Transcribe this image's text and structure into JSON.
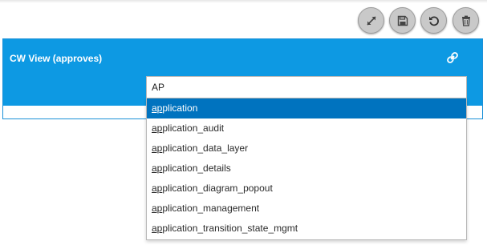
{
  "toolbar": {
    "buttons": [
      {
        "name": "expand",
        "icon": "expand-icon"
      },
      {
        "name": "save",
        "icon": "save-icon"
      },
      {
        "name": "refresh",
        "icon": "refresh-icon"
      },
      {
        "name": "delete",
        "icon": "trash-icon"
      }
    ]
  },
  "panel": {
    "title": "CW View (approves)",
    "link_icon": "link-icon",
    "header_color": "#0d99e3"
  },
  "search": {
    "value": "AP",
    "placeholder": ""
  },
  "dropdown": {
    "selected_index": 0,
    "selected_color": "#0073bf",
    "options": [
      {
        "match": "ap",
        "rest": "plication"
      },
      {
        "match": "ap",
        "rest": "plication_audit"
      },
      {
        "match": "ap",
        "rest": "plication_data_layer"
      },
      {
        "match": "ap",
        "rest": "plication_details"
      },
      {
        "match": "ap",
        "rest": "plication_diagram_popout"
      },
      {
        "match": "ap",
        "rest": "plication_management"
      },
      {
        "match": "ap",
        "rest": "plication_transition_state_mgmt"
      }
    ]
  }
}
